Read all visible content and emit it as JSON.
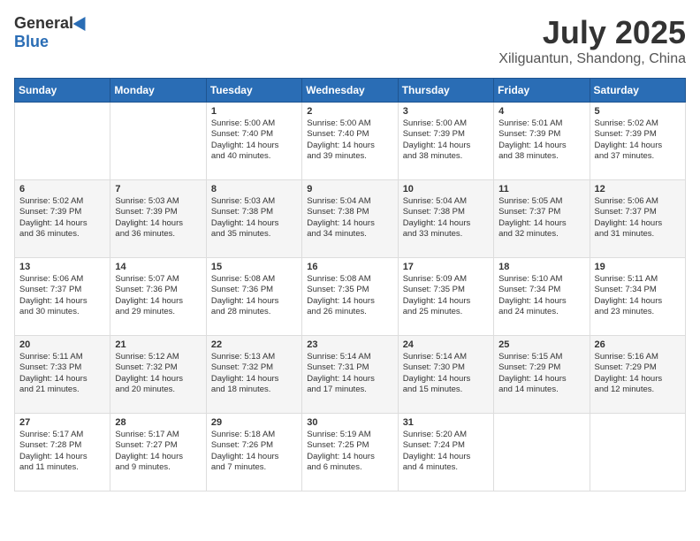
{
  "header": {
    "logo_general": "General",
    "logo_blue": "Blue",
    "month": "July 2025",
    "location": "Xiliguantun, Shandong, China"
  },
  "weekdays": [
    "Sunday",
    "Monday",
    "Tuesday",
    "Wednesday",
    "Thursday",
    "Friday",
    "Saturday"
  ],
  "weeks": [
    [
      {
        "day": "",
        "info": ""
      },
      {
        "day": "",
        "info": ""
      },
      {
        "day": "1",
        "info": "Sunrise: 5:00 AM\nSunset: 7:40 PM\nDaylight: 14 hours\nand 40 minutes."
      },
      {
        "day": "2",
        "info": "Sunrise: 5:00 AM\nSunset: 7:40 PM\nDaylight: 14 hours\nand 39 minutes."
      },
      {
        "day": "3",
        "info": "Sunrise: 5:00 AM\nSunset: 7:39 PM\nDaylight: 14 hours\nand 38 minutes."
      },
      {
        "day": "4",
        "info": "Sunrise: 5:01 AM\nSunset: 7:39 PM\nDaylight: 14 hours\nand 38 minutes."
      },
      {
        "day": "5",
        "info": "Sunrise: 5:02 AM\nSunset: 7:39 PM\nDaylight: 14 hours\nand 37 minutes."
      }
    ],
    [
      {
        "day": "6",
        "info": "Sunrise: 5:02 AM\nSunset: 7:39 PM\nDaylight: 14 hours\nand 36 minutes."
      },
      {
        "day": "7",
        "info": "Sunrise: 5:03 AM\nSunset: 7:39 PM\nDaylight: 14 hours\nand 36 minutes."
      },
      {
        "day": "8",
        "info": "Sunrise: 5:03 AM\nSunset: 7:38 PM\nDaylight: 14 hours\nand 35 minutes."
      },
      {
        "day": "9",
        "info": "Sunrise: 5:04 AM\nSunset: 7:38 PM\nDaylight: 14 hours\nand 34 minutes."
      },
      {
        "day": "10",
        "info": "Sunrise: 5:04 AM\nSunset: 7:38 PM\nDaylight: 14 hours\nand 33 minutes."
      },
      {
        "day": "11",
        "info": "Sunrise: 5:05 AM\nSunset: 7:37 PM\nDaylight: 14 hours\nand 32 minutes."
      },
      {
        "day": "12",
        "info": "Sunrise: 5:06 AM\nSunset: 7:37 PM\nDaylight: 14 hours\nand 31 minutes."
      }
    ],
    [
      {
        "day": "13",
        "info": "Sunrise: 5:06 AM\nSunset: 7:37 PM\nDaylight: 14 hours\nand 30 minutes."
      },
      {
        "day": "14",
        "info": "Sunrise: 5:07 AM\nSunset: 7:36 PM\nDaylight: 14 hours\nand 29 minutes."
      },
      {
        "day": "15",
        "info": "Sunrise: 5:08 AM\nSunset: 7:36 PM\nDaylight: 14 hours\nand 28 minutes."
      },
      {
        "day": "16",
        "info": "Sunrise: 5:08 AM\nSunset: 7:35 PM\nDaylight: 14 hours\nand 26 minutes."
      },
      {
        "day": "17",
        "info": "Sunrise: 5:09 AM\nSunset: 7:35 PM\nDaylight: 14 hours\nand 25 minutes."
      },
      {
        "day": "18",
        "info": "Sunrise: 5:10 AM\nSunset: 7:34 PM\nDaylight: 14 hours\nand 24 minutes."
      },
      {
        "day": "19",
        "info": "Sunrise: 5:11 AM\nSunset: 7:34 PM\nDaylight: 14 hours\nand 23 minutes."
      }
    ],
    [
      {
        "day": "20",
        "info": "Sunrise: 5:11 AM\nSunset: 7:33 PM\nDaylight: 14 hours\nand 21 minutes."
      },
      {
        "day": "21",
        "info": "Sunrise: 5:12 AM\nSunset: 7:32 PM\nDaylight: 14 hours\nand 20 minutes."
      },
      {
        "day": "22",
        "info": "Sunrise: 5:13 AM\nSunset: 7:32 PM\nDaylight: 14 hours\nand 18 minutes."
      },
      {
        "day": "23",
        "info": "Sunrise: 5:14 AM\nSunset: 7:31 PM\nDaylight: 14 hours\nand 17 minutes."
      },
      {
        "day": "24",
        "info": "Sunrise: 5:14 AM\nSunset: 7:30 PM\nDaylight: 14 hours\nand 15 minutes."
      },
      {
        "day": "25",
        "info": "Sunrise: 5:15 AM\nSunset: 7:29 PM\nDaylight: 14 hours\nand 14 minutes."
      },
      {
        "day": "26",
        "info": "Sunrise: 5:16 AM\nSunset: 7:29 PM\nDaylight: 14 hours\nand 12 minutes."
      }
    ],
    [
      {
        "day": "27",
        "info": "Sunrise: 5:17 AM\nSunset: 7:28 PM\nDaylight: 14 hours\nand 11 minutes."
      },
      {
        "day": "28",
        "info": "Sunrise: 5:17 AM\nSunset: 7:27 PM\nDaylight: 14 hours\nand 9 minutes."
      },
      {
        "day": "29",
        "info": "Sunrise: 5:18 AM\nSunset: 7:26 PM\nDaylight: 14 hours\nand 7 minutes."
      },
      {
        "day": "30",
        "info": "Sunrise: 5:19 AM\nSunset: 7:25 PM\nDaylight: 14 hours\nand 6 minutes."
      },
      {
        "day": "31",
        "info": "Sunrise: 5:20 AM\nSunset: 7:24 PM\nDaylight: 14 hours\nand 4 minutes."
      },
      {
        "day": "",
        "info": ""
      },
      {
        "day": "",
        "info": ""
      }
    ]
  ]
}
